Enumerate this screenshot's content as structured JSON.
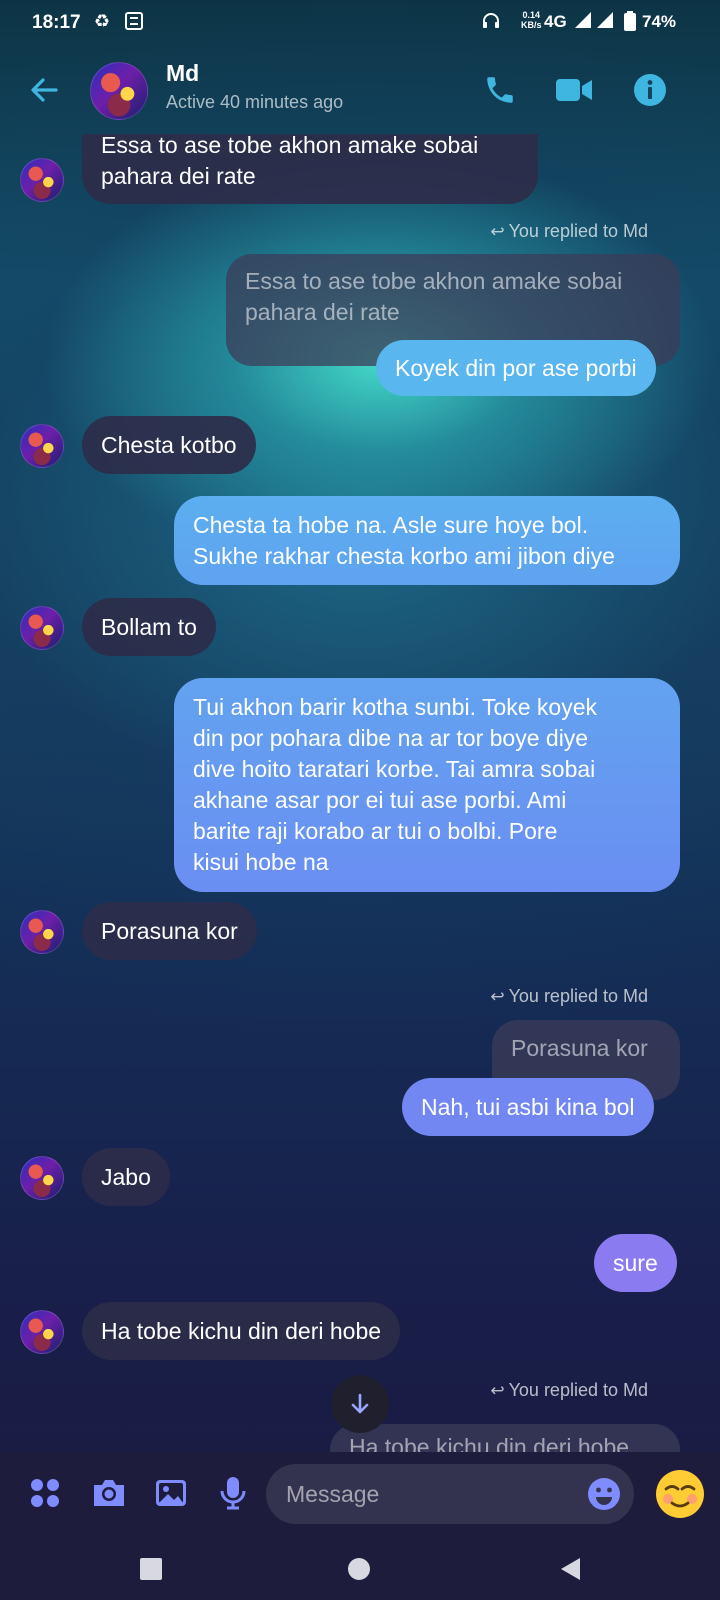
{
  "status_bar": {
    "time": "18:17",
    "speed_value": "0.14",
    "speed_unit": "KB/s",
    "network": "4G",
    "battery": "74%"
  },
  "header": {
    "contact_name": "Md",
    "active_status": "Active 40 minutes ago"
  },
  "messages": {
    "m1": [
      "Essa to ase tobe akhon amake sobai",
      "pahara dei rate"
    ],
    "reply1_note": "You replied to Md",
    "quote1": [
      "Essa to ase tobe akhon amake sobai",
      "pahara dei rate"
    ],
    "m2": "Koyek din por ase porbi",
    "m3": "Chesta kotbo",
    "m4": [
      "Chesta ta hobe na.  Asle sure hoye bol.",
      "Sukhe rakhar chesta korbo ami jibon diye"
    ],
    "m5": "Bollam to",
    "m6": [
      "Tui akhon barir kotha sunbi. Toke koyek",
      "din por pohara dibe na ar tor boye diye",
      "dive hoito taratari korbe.  Tai amra sobai",
      "akhane asar por ei tui ase porbi.  Ami",
      "barite raji korabo ar tui o bolbi.  Pore",
      "kisui hobe na"
    ],
    "m7": "Porasuna kor",
    "reply2_note": "You replied to Md",
    "quote2": "Porasuna kor",
    "m8": "Nah,  tui asbi kina bol",
    "m9": "Jabo",
    "m10": "sure",
    "m11": "Ha tobe kichu din deri hobe",
    "reply3_note": "You replied to Md",
    "quote3": "Ha tobe kichu din deri hobe"
  },
  "composer": {
    "placeholder": "Message"
  },
  "colors": {
    "accent": "#3fb6e0",
    "bubble_incoming": "#2c2c4a",
    "bubble_out_top": "#5cb0f0",
    "bubble_out_mid": "#6a8df2",
    "bubble_out_bottom": "#8a7cf0"
  },
  "icons": {
    "header": [
      "back-arrow-icon",
      "phone-icon",
      "video-camera-icon",
      "info-icon"
    ],
    "composer": [
      "apps-icon",
      "camera-icon",
      "gallery-icon",
      "microphone-icon",
      "emoji-icon",
      "smiling-emoji-icon"
    ],
    "navigation": [
      "recents-icon",
      "home-icon",
      "back-icon"
    ]
  }
}
